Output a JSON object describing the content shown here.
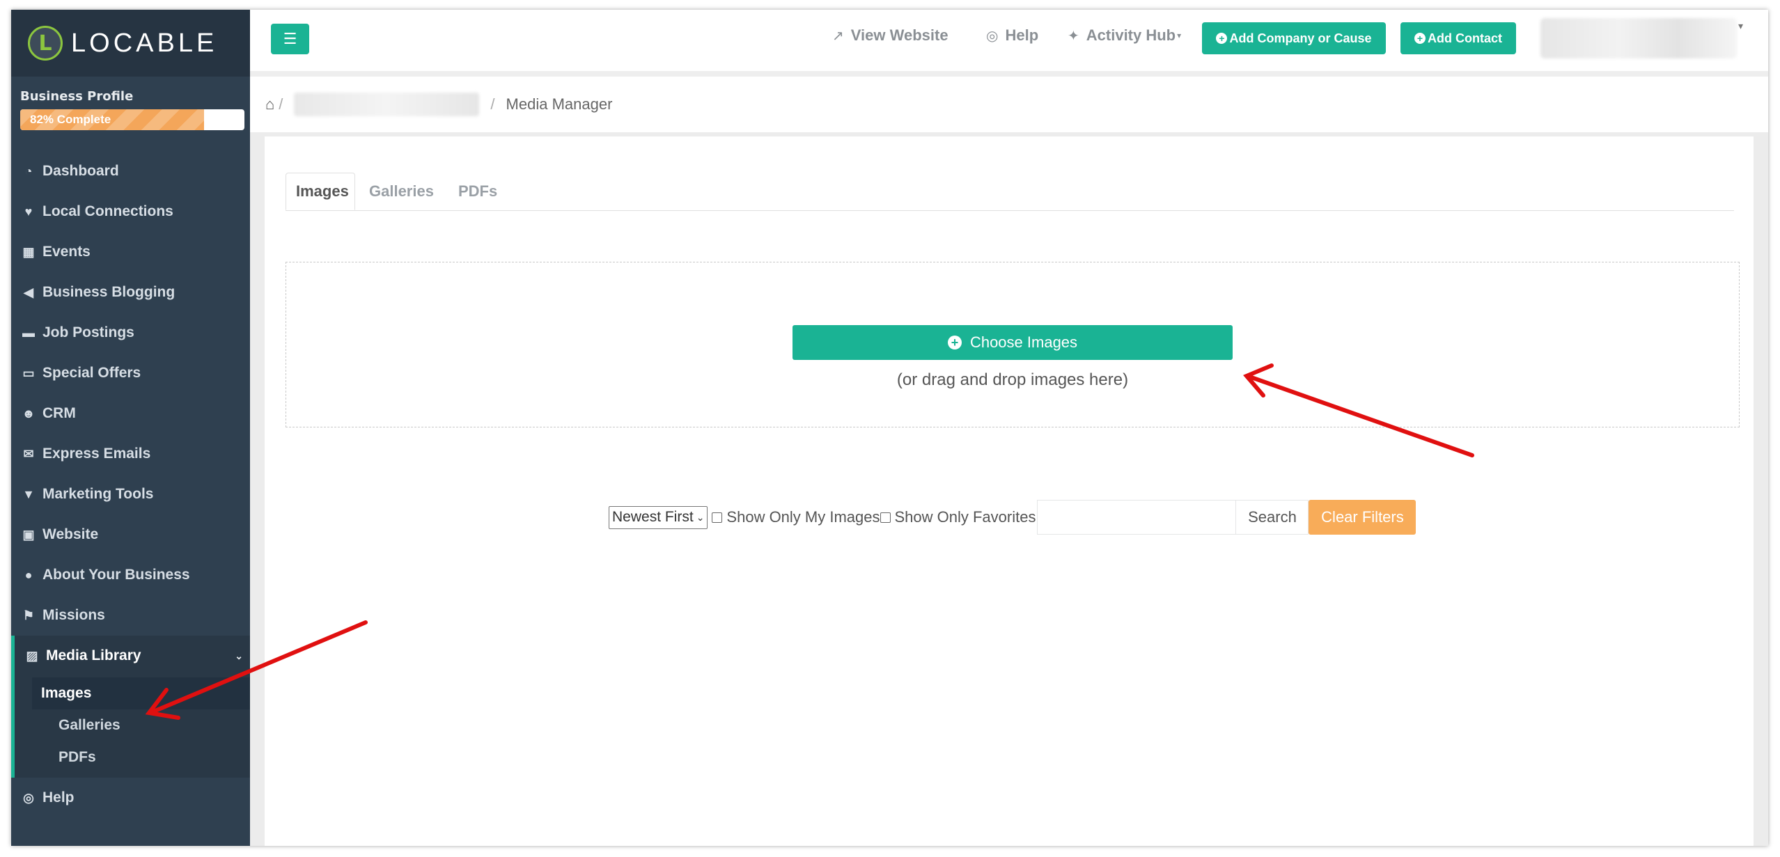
{
  "brand": {
    "logo_letter": "L",
    "name": "LOCABLE"
  },
  "profile": {
    "label": "Business Profile",
    "progress_text": "82% Complete",
    "progress": 0.82
  },
  "sidebar": {
    "items": [
      {
        "label": "Dashboard",
        "icon": "dashboard-icon"
      },
      {
        "label": "Local Connections",
        "icon": "heartbeat-icon"
      },
      {
        "label": "Events",
        "icon": "calendar-icon"
      },
      {
        "label": "Business Blogging",
        "icon": "bullhorn-icon"
      },
      {
        "label": "Job Postings",
        "icon": "briefcase-icon"
      },
      {
        "label": "Special Offers",
        "icon": "ticket-icon"
      },
      {
        "label": "CRM",
        "icon": "users-icon"
      },
      {
        "label": "Express Emails",
        "icon": "envelope-icon"
      },
      {
        "label": "Marketing Tools",
        "icon": "filter-icon"
      },
      {
        "label": "Website",
        "icon": "monitor-icon"
      },
      {
        "label": "About Your Business",
        "icon": "map-marker-icon"
      },
      {
        "label": "Missions",
        "icon": "flag-icon"
      }
    ],
    "active": {
      "label": "Media Library",
      "icon": "image-icon"
    },
    "sub_items": [
      "Images",
      "Galleries",
      "PDFs"
    ],
    "help": {
      "label": "Help",
      "icon": "life-ring-icon"
    }
  },
  "topbar": {
    "view_website": "View Website",
    "help": "Help",
    "activity_hub": "Activity Hub",
    "add_company": "Add Company or Cause",
    "add_contact": "Add Contact"
  },
  "breadcrumb": {
    "separator": "/",
    "current": "Media Manager"
  },
  "tabs": [
    "Images",
    "Galleries",
    "PDFs"
  ],
  "upload": {
    "button": "Choose Images",
    "hint": "(or drag and drop images here)"
  },
  "filters": {
    "sort_selected": "Newest First",
    "show_mine": "Show Only My Images",
    "show_favorites": "Show Only Favorites",
    "search_placeholder": "",
    "search_button": "Search",
    "clear_button": "Clear Filters"
  },
  "colors": {
    "accent": "#1ab394",
    "sidebar": "#2f4050",
    "warning": "#f8ac59",
    "annotation": "#e01010"
  }
}
